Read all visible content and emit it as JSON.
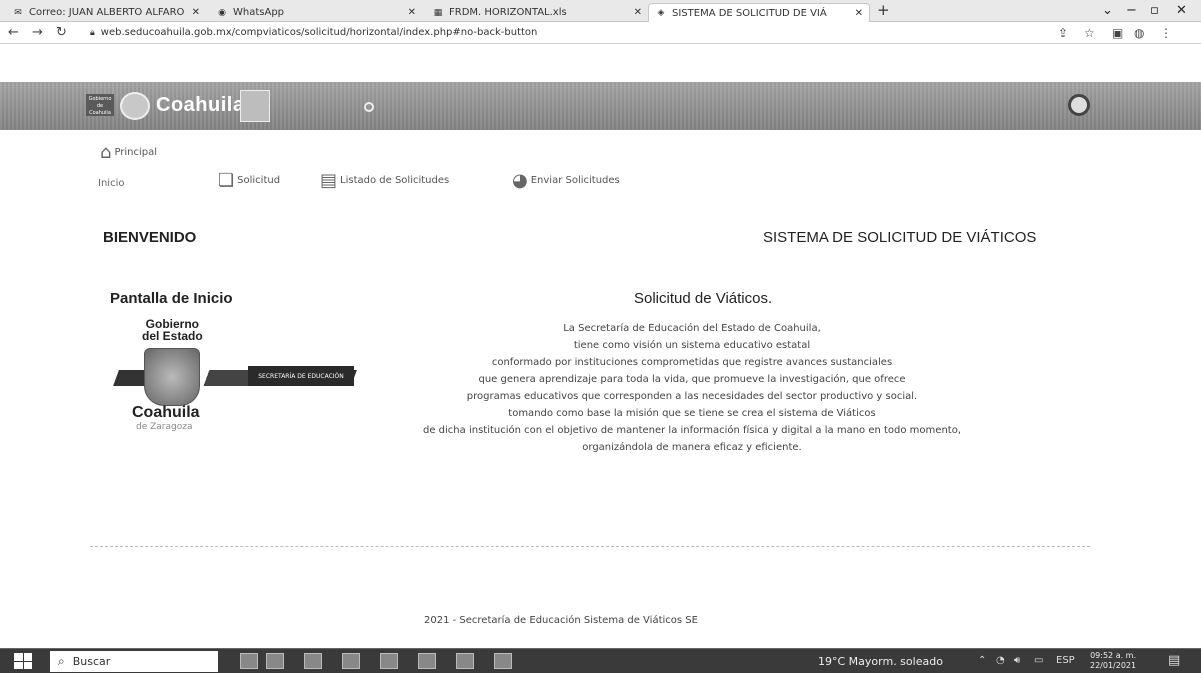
{
  "browser": {
    "tabs": [
      {
        "label": "Correo: JUAN ALBERTO ALFARO",
        "icon": "mail-icon"
      },
      {
        "label": "WhatsApp",
        "icon": "whatsapp-icon"
      },
      {
        "label": "FRDM. HORIZONTAL.xls",
        "icon": "excel-icon"
      },
      {
        "label": "SISTEMA DE SOLICITUD DE VIÁ",
        "icon": "site-icon"
      }
    ],
    "url": "web.seducoahuila.gob.mx/compviaticos/solicitud/horizontal/index.php#no-back-button"
  },
  "header": {
    "title": "Coahuila",
    "badge": "Gobierno de Coahuila"
  },
  "nav": {
    "principal": "Principal",
    "inicio": "Inicio",
    "solicitud": "Solicitud",
    "listado": "Listado de Solicitudes",
    "enviar": "Enviar Solicitudes"
  },
  "main": {
    "welcome": "BIENVENIDO",
    "system_title": "SISTEMA DE SOLICITUD DE VIÁTICOS",
    "screen_title": "Pantalla de Inicio",
    "logo": {
      "gobierno": "Gobierno",
      "del_estado": "del Estado",
      "coahuila": "Coahuila",
      "zaragoza": "de Zaragoza",
      "secretaria": "SECRETARÍA DE EDUCACIÓN"
    },
    "solicitud_title": "Solicitud de Viáticos.",
    "paragraph": [
      "La Secretaría de Educación del Estado de Coahuila,",
      "tiene como visión un sistema educativo estatal",
      "conformado por instituciones comprometidas que registre avances sustanciales",
      "que genera aprendizaje para toda la vida, que promueve la investigación, que ofrece",
      "programas educativos que corresponden a las necesidades del sector productivo y social.",
      "tomando como base la misión que se tiene se crea el sistema de Viáticos",
      "de dicha institución con el objetivo de mantener la información física y digital a la mano en todo momento,",
      "organizándola de manera eficaz y eficiente."
    ],
    "footer": "2021 - Secretaría de Educación Sistema de Viáticos SE"
  },
  "taskbar": {
    "search": "Buscar",
    "weather": "19°C  Mayorm. soleado",
    "lang": "ESP",
    "time": "09:52 a. m.",
    "date": "22/01/2021"
  }
}
